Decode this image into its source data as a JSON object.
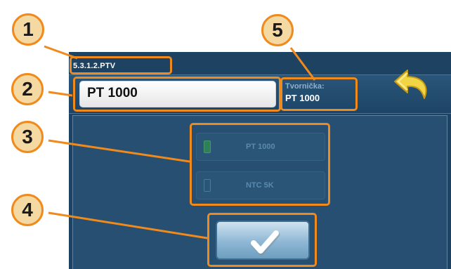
{
  "menu": {
    "path": "5.3.1.2.PTV"
  },
  "sensor": {
    "current_value": "PT 1000"
  },
  "factory": {
    "label": "Tvornička:",
    "value": "PT 1000"
  },
  "options": [
    {
      "label": "PT 1000",
      "selected": true
    },
    {
      "label": "NTC 5K",
      "selected": false
    }
  ],
  "callouts": [
    "1",
    "2",
    "3",
    "4",
    "5"
  ],
  "icons": {
    "back": "back-arrow-icon",
    "confirm": "checkmark-icon"
  },
  "colors": {
    "callout_orange": "#f08a1c",
    "screen_blue": "#1d4262",
    "back_arrow_yellow": "#f2d544"
  }
}
